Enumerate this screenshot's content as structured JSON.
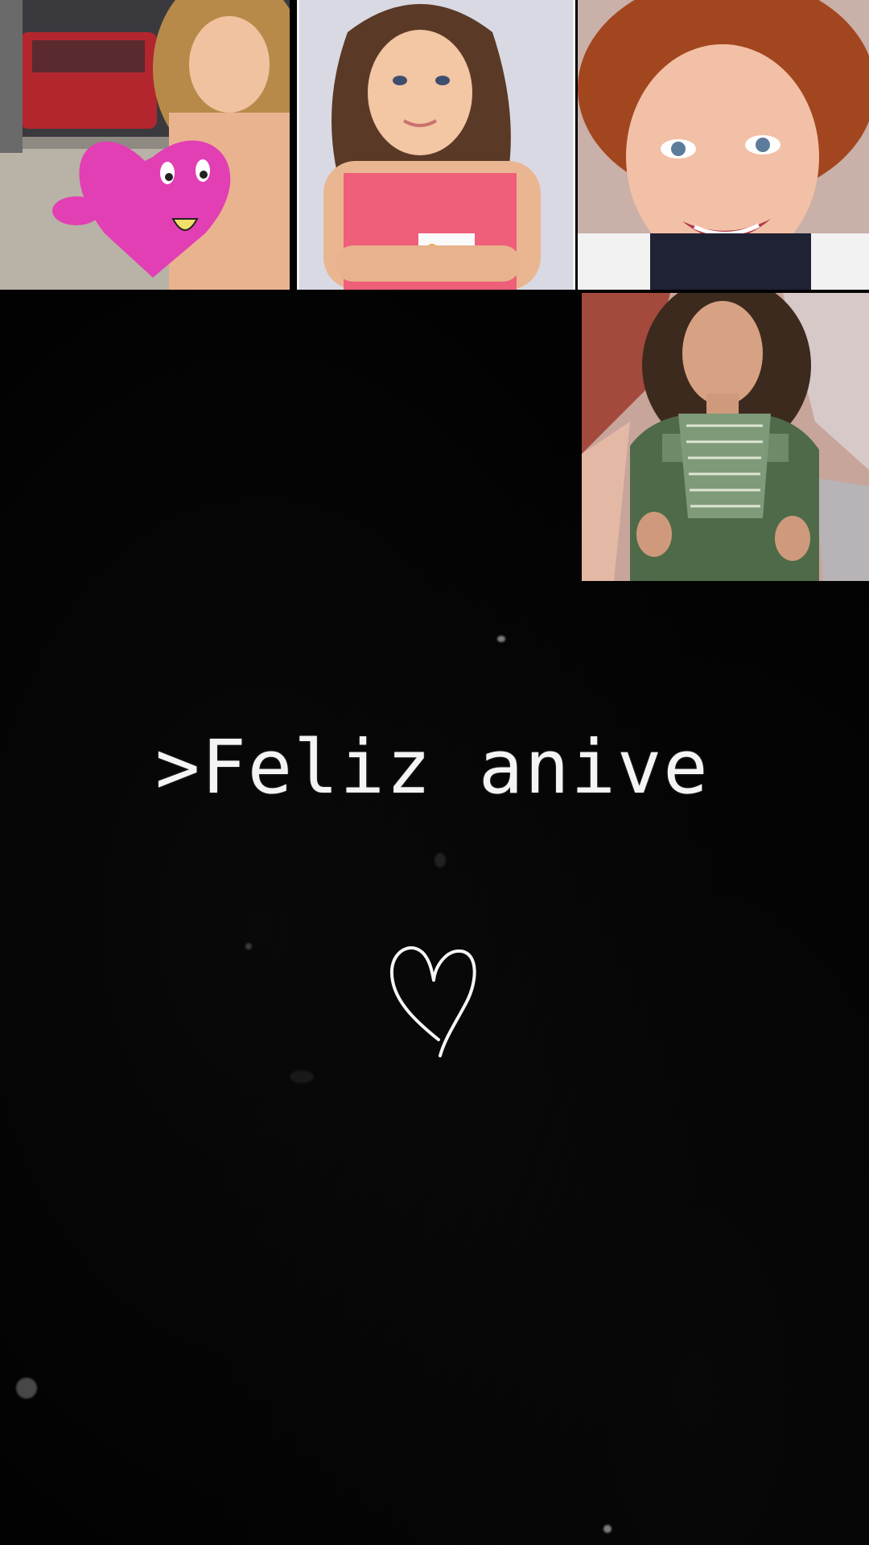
{
  "story": {
    "caption": ">Feliz anive",
    "heart_icon": "hand-drawn-heart-outline",
    "background_color": "#020202",
    "photos": [
      {
        "name": "photo-girl-with-pink-heart-plush"
      },
      {
        "name": "photo-girl-pink-top-arms-crossed"
      },
      {
        "name": "photo-red-haired-toddler-smiling"
      },
      {
        "name": "photo-woman-green-embroidered-blouse"
      }
    ]
  }
}
